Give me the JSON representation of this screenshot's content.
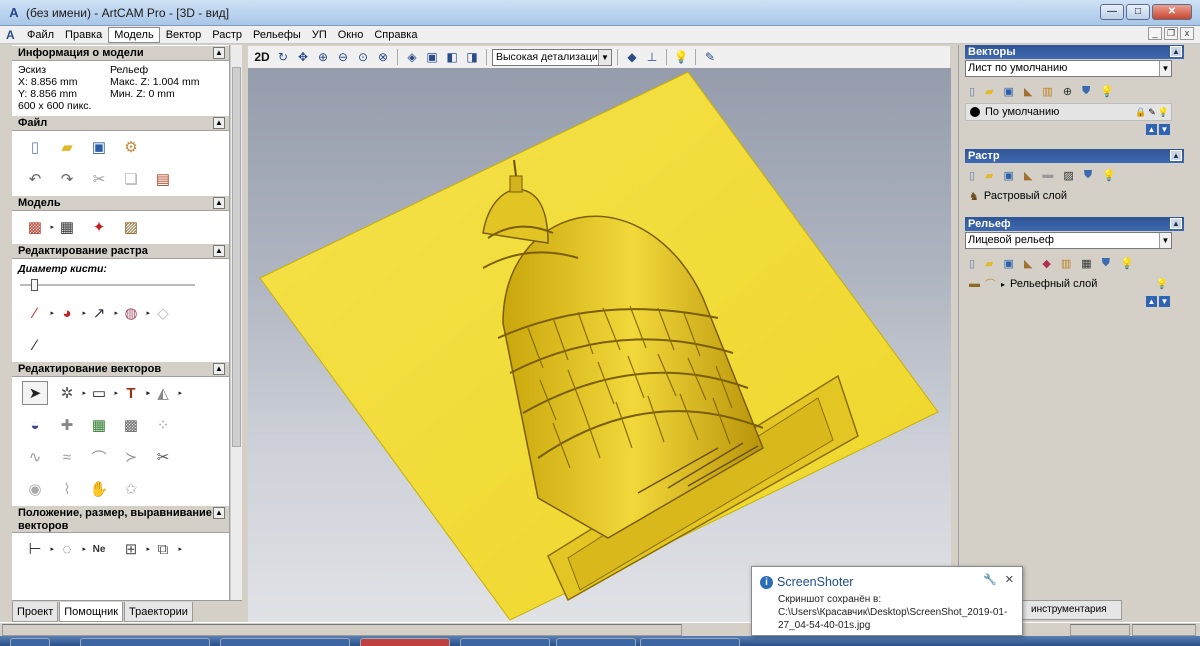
{
  "window": {
    "title": "(без имени) - ArtCAM Pro - [3D - вид]",
    "icon": "artcam-logo-icon"
  },
  "menu": {
    "items": [
      "Файл",
      "Правка",
      "Модель",
      "Вектор",
      "Растр",
      "Рельефы",
      "УП",
      "Окно",
      "Справка"
    ],
    "active": "Модель"
  },
  "left": {
    "model_info": {
      "title": "Информация о модели",
      "sketch_label": "Эскиз",
      "sketch_x": "X: 8.856 mm",
      "sketch_y": "Y: 8.856 mm",
      "sketch_px": "600 x 600 пикс.",
      "relief_label": "Рельеф",
      "relief_max": "Макс. Z: 1.004 mm",
      "relief_min": "Мин. Z: 0 mm"
    },
    "file": {
      "title": "Файл"
    },
    "model": {
      "title": "Модель"
    },
    "raster_edit": {
      "title": "Редактирование растра",
      "brush_label": "Диаметр кисти:",
      "brush_value": 0.06
    },
    "vector_edit": {
      "title": "Редактирование векторов"
    },
    "position": {
      "title": "Положение, размер, выравнивание векторов"
    },
    "tabs": [
      "Проект",
      "Помощник",
      "Траектории"
    ],
    "active_tab": "Помощник"
  },
  "view_toolbar": {
    "btn_2d": "2D",
    "detail": "Высокая детализация"
  },
  "right": {
    "vectors": {
      "title": "Векторы",
      "sheet": "Лист по умолчанию",
      "layer": "По умолчанию"
    },
    "raster": {
      "title": "Растр",
      "layer": "Растровый слой"
    },
    "relief": {
      "title": "Рельеф",
      "select": "Лицевой рельеф",
      "layer": "Рельефный слой"
    },
    "tool_tab": "инструментария"
  },
  "toast": {
    "title": "ScreenShoter",
    "line1": "Скриншот сохранён в:",
    "line2": "C:\\Users\\Красавчик\\Desktop\\ScreenShot_2019-01-",
    "line3": "27_04-54-40-01s.jpg"
  },
  "colors": {
    "relief_gold": "#f2dd3a",
    "panel_header": "#2f5597"
  }
}
